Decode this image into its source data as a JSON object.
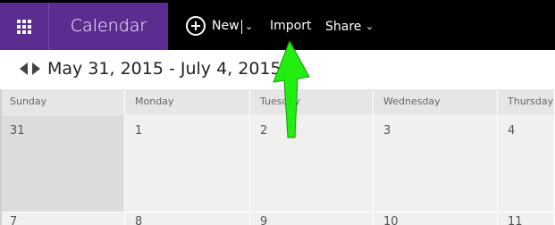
{
  "app": {
    "name": "Calendar"
  },
  "toolbar": {
    "new_label": "New",
    "import_label": "Import",
    "share_label": "Share"
  },
  "range": {
    "title": "May 31, 2015 - July 4, 2015"
  },
  "weekdays": [
    "Sunday",
    "Monday",
    "Tuesday",
    "Wednesday",
    "Thursday"
  ],
  "week1": [
    "31",
    "1",
    "2",
    "3",
    "4"
  ],
  "week2": [
    "7",
    "8",
    "9",
    "10",
    "11"
  ],
  "colors": {
    "brand": "#5c2d91",
    "topbar": "#000000",
    "annotation": "#22ee11"
  },
  "icons": {
    "app_launcher": "waffle-grid-icon",
    "new": "plus-circle-icon",
    "prev": "triangle-left-icon",
    "next": "triangle-right-icon"
  }
}
